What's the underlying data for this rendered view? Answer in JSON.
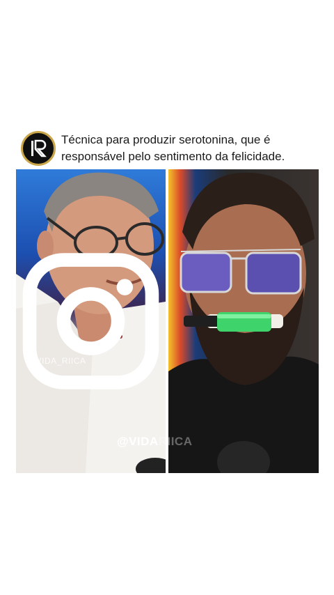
{
  "post": {
    "avatar_icon": "ir-logo-icon",
    "caption_line1": "Técnica para produzir serotonina, que é",
    "caption_line2": "responsável pelo sentimento da felicidade."
  },
  "left_video": {
    "instagram_icon": "instagram-icon",
    "handle": "@VIDA_RIICA"
  },
  "bottom_watermark": {
    "part1": "@VIDA",
    "part2": "RIICA"
  },
  "colors": {
    "avatar_ring": "#caa64a",
    "avatar_bg": "#0f0f0f",
    "highlighter": "#3fd36b"
  }
}
